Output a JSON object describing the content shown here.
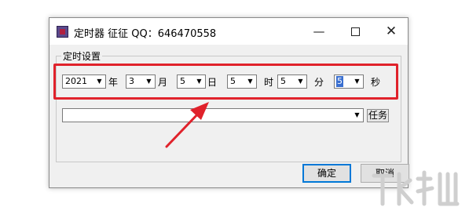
{
  "window": {
    "title": "定时器 征征 QQ：646470558",
    "minimize_glyph": "—",
    "close_glyph": "✕"
  },
  "group": {
    "label": "定时设置"
  },
  "datetime": {
    "year": {
      "value": "2021",
      "unit": "年"
    },
    "month": {
      "value": "3",
      "unit": "月"
    },
    "day": {
      "value": "5",
      "unit": "日"
    },
    "hour": {
      "value": "5",
      "unit": "时"
    },
    "minute": {
      "value": "5",
      "unit": "分"
    },
    "second": {
      "value": "5",
      "unit": "秒"
    }
  },
  "task": {
    "value": "",
    "button_label": "任务"
  },
  "buttons": {
    "ok_label": "确定",
    "cancel_label": "取消"
  },
  "annotation": {
    "color": "#e0222b"
  },
  "icons": {
    "dropdown": "▼"
  }
}
